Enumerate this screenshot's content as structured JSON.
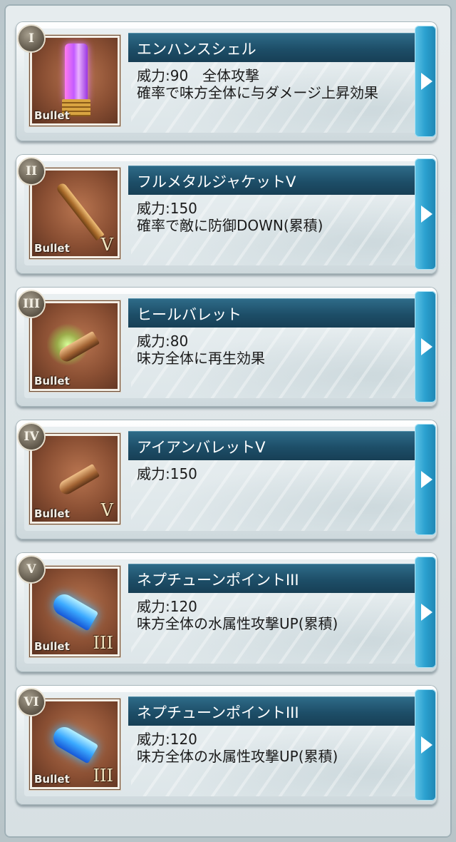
{
  "thumb_label": "Bullet",
  "colors": {
    "titlebar": "#1d4e68",
    "arrow_tab": "#2aa0cf",
    "thumb_bg": "#8a4f33"
  },
  "bullets": [
    {
      "numeral": "I",
      "name": "エンハンスシェル",
      "lines": [
        "威力:90　全体攻撃",
        "確率で味方全体に与ダメージ上昇効果"
      ],
      "rank": "",
      "icon": "purple-shell-icon"
    },
    {
      "numeral": "II",
      "name": "フルメタルジャケットV",
      "lines": [
        "威力:150",
        "確率で敵に防御DOWN(累積)"
      ],
      "rank": "V",
      "icon": "rifle-bullet-icon"
    },
    {
      "numeral": "III",
      "name": "ヒールバレット",
      "lines": [
        "威力:80",
        "味方全体に再生効果"
      ],
      "rank": "",
      "icon": "heal-bullet-icon"
    },
    {
      "numeral": "IV",
      "name": "アイアンバレットV",
      "lines": [
        "威力:150"
      ],
      "rank": "V",
      "icon": "iron-bullet-icon"
    },
    {
      "numeral": "V",
      "name": "ネプチューンポイントIII",
      "lines": [
        "威力:120",
        "味方全体の水属性攻撃UP(累積)"
      ],
      "rank": "III",
      "icon": "water-bullet-icon"
    },
    {
      "numeral": "VI",
      "name": "ネプチューンポイントIII",
      "lines": [
        "威力:120",
        "味方全体の水属性攻撃UP(累積)"
      ],
      "rank": "III",
      "icon": "water-bullet-icon"
    }
  ]
}
